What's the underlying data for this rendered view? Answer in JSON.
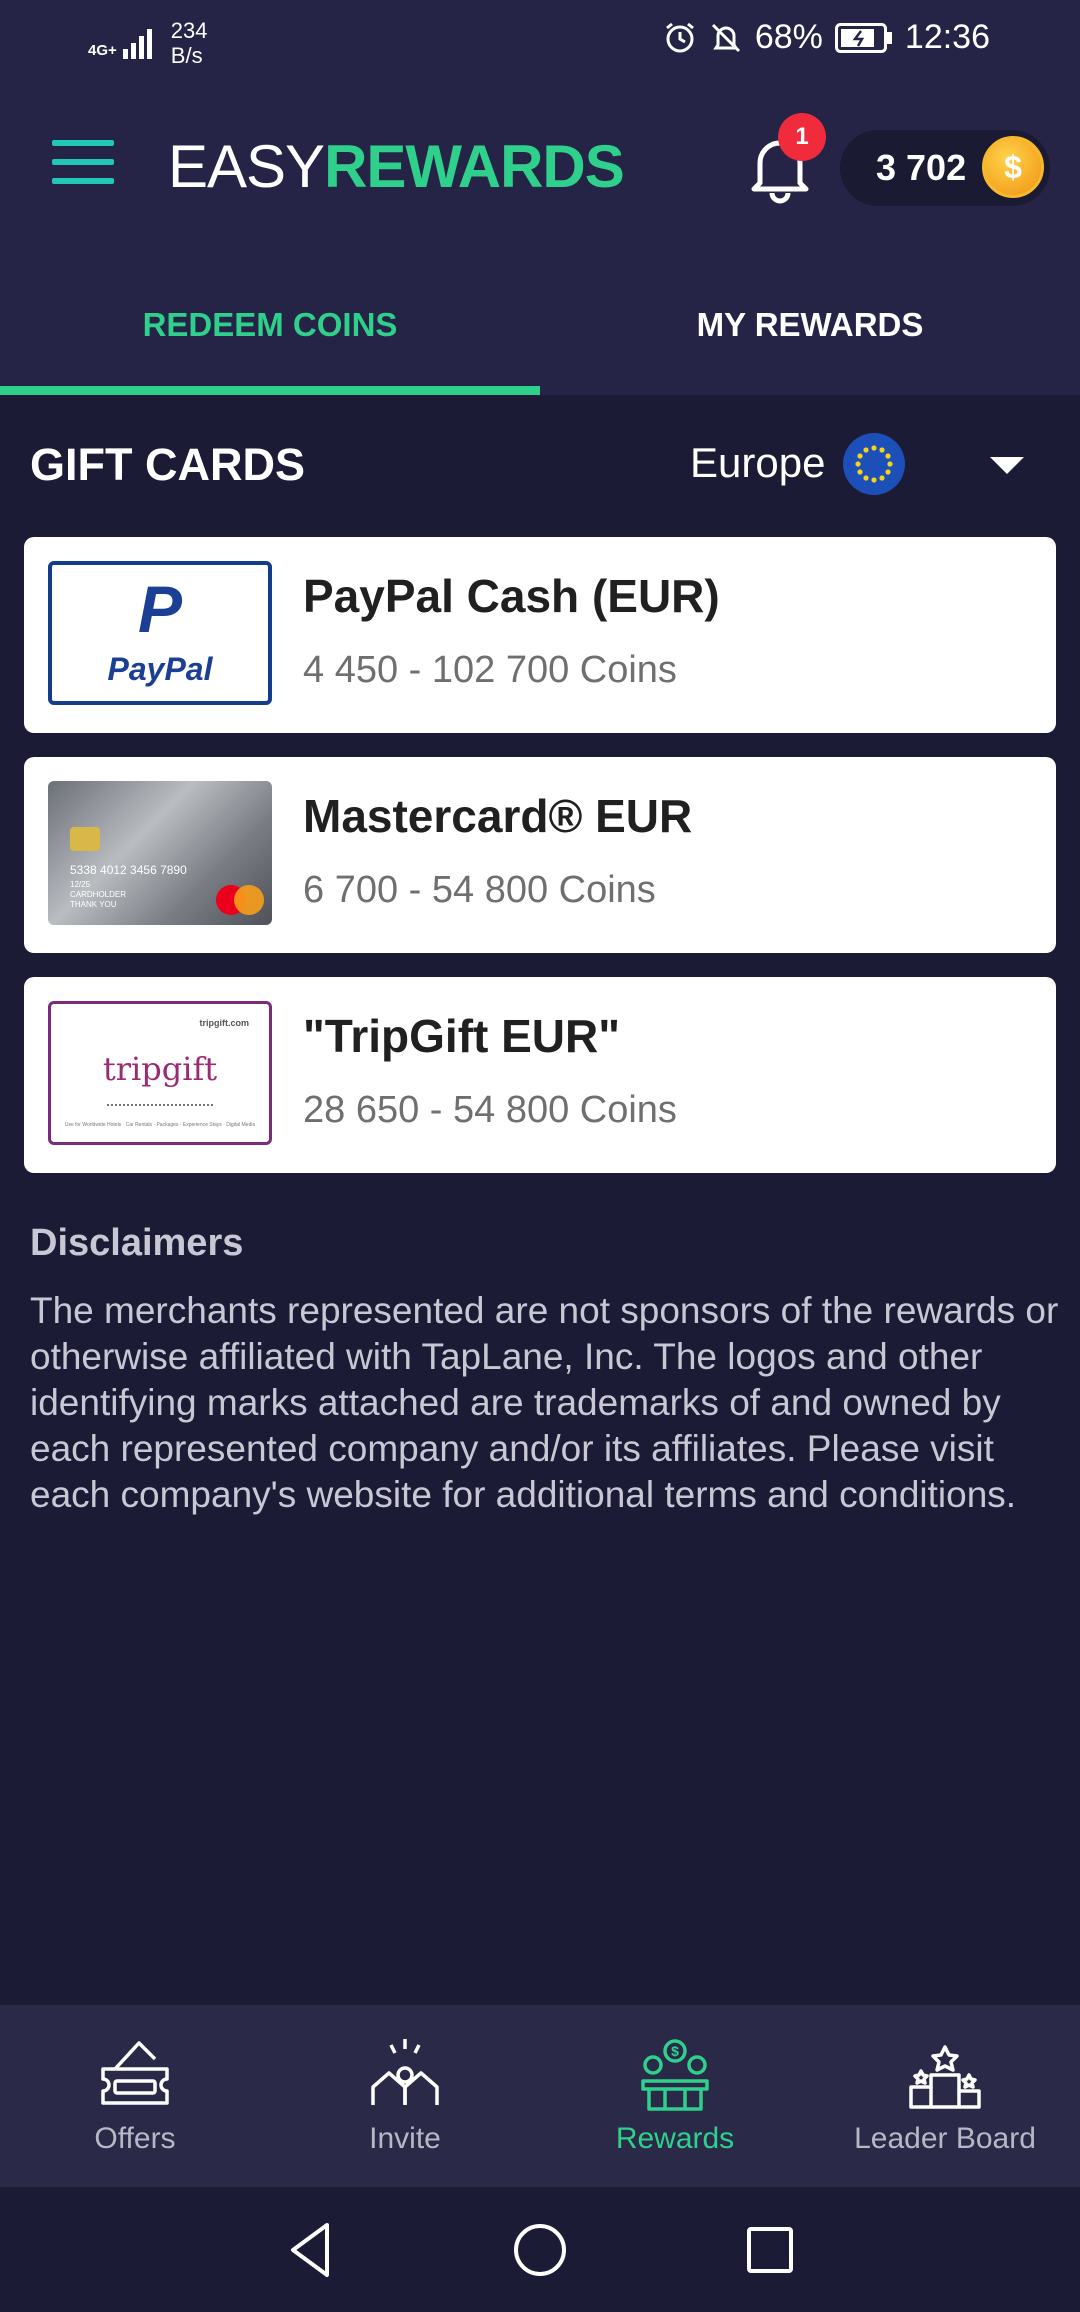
{
  "status_bar": {
    "network": "4G+",
    "speed_value": "234",
    "speed_unit": "B/s",
    "battery": "68%",
    "time": "12:36"
  },
  "header": {
    "logo_part1": "EASY",
    "logo_part2": "REWARDS",
    "notification_count": "1",
    "coin_balance": "3 702",
    "coin_symbol": "$"
  },
  "tabs": [
    {
      "label": "REDEEM COINS",
      "active": true
    },
    {
      "label": "MY REWARDS",
      "active": false
    }
  ],
  "section": {
    "title": "GIFT CARDS",
    "region": "Europe"
  },
  "gift_cards": [
    {
      "name": "PayPal Cash (EUR)",
      "range": "4 450 - 102 700 Coins",
      "logo_text": "PayPal",
      "logo_mark": "P"
    },
    {
      "name": "Mastercard® EUR",
      "range": "6 700 - 54 800 Coins",
      "card_number": "5338 4012 3456 7890",
      "card_line2": "12/25",
      "card_holder": "CARDHOLDER",
      "card_line4": "THANK YOU"
    },
    {
      "name": "\"TripGift EUR\"",
      "range": "28 650 - 54 800 Coins",
      "site": "tripgift.com",
      "logo_text": "tripgift",
      "tagline": "Use for Worldwide Hotels · Car Rentals · Packages · Experience Stays · Digital Media"
    }
  ],
  "disclaimers": {
    "title": "Disclaimers",
    "text": "The merchants represented are not sponsors of the rewards or otherwise affiliated with TapLane, Inc. The logos and other identifying marks attached are trademarks of and owned by each represented company and/or its affiliates. Please visit each company's website for additional terms and conditions."
  },
  "bottom_nav": [
    {
      "label": "Offers",
      "icon": "ticket-icon",
      "active": false
    },
    {
      "label": "Invite",
      "icon": "people-icon",
      "active": false
    },
    {
      "label": "Rewards",
      "icon": "rewards-icon",
      "active": true
    },
    {
      "label": "Leader Board",
      "icon": "podium-icon",
      "active": false
    }
  ],
  "colors": {
    "background": "#1c1b36",
    "surface": "#252446",
    "accent_green": "#2ed08b",
    "accent_teal": "#22c7b7",
    "badge_red": "#f02c3c",
    "coin_gold": "#f5a623"
  }
}
